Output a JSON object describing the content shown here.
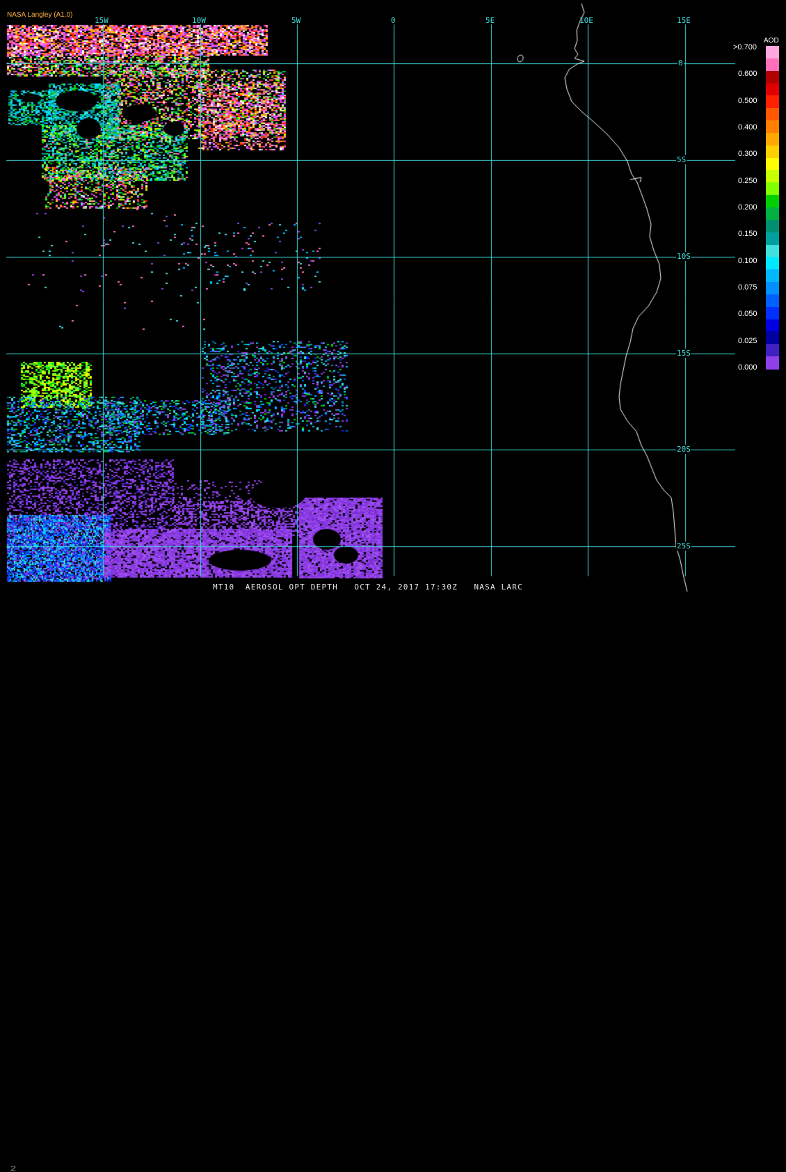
{
  "header": {
    "credit": "NASA Langley (A1.0)"
  },
  "footer": {
    "title": "MT10  AEROSOL OPT DEPTH   OCT 24, 2017 17:30Z   NASA LARC"
  },
  "map": {
    "lon_labels": [
      "15W",
      "10W",
      "5W",
      "0",
      "5E",
      "10E",
      "15E"
    ],
    "lat_labels": [
      "0",
      "5S",
      "10S",
      "15S",
      "20S",
      "25S"
    ],
    "grid_color": "#40e0e0",
    "coast_color": "#ffffff"
  },
  "legend": {
    "title": "AOD",
    "tick_labels": [
      ">0.700",
      "0.600",
      "0.500",
      "0.400",
      "0.300",
      "0.250",
      "0.200",
      "0.150",
      "0.100",
      "0.075",
      "0.050",
      "0.025",
      "0.000"
    ],
    "colors": [
      "#ffa8e0",
      "#ff70b8",
      "#b00000",
      "#e00000",
      "#ff2000",
      "#ff5800",
      "#ff8000",
      "#ffa800",
      "#ffd000",
      "#ffff00",
      "#c8ff00",
      "#80ff00",
      "#00d000",
      "#00b040",
      "#009070",
      "#00a0a0",
      "#40e0e0",
      "#00e8ff",
      "#00b8ff",
      "#0090ff",
      "#0060ff",
      "#0030ff",
      "#0000e0",
      "#0000a0",
      "#4020c0",
      "#9040e8"
    ]
  }
}
